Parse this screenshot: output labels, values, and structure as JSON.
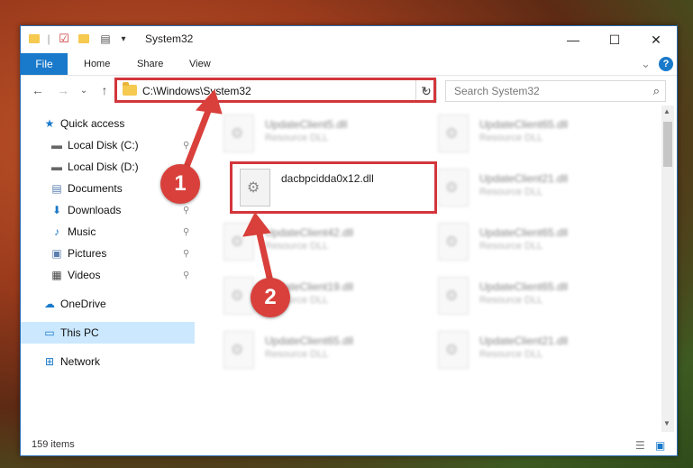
{
  "window": {
    "title": "System32",
    "minimize": "—",
    "maximize": "☐",
    "close": "✕"
  },
  "ribbon": {
    "file": "File",
    "home": "Home",
    "share": "Share",
    "view": "View",
    "collapse": "⌄",
    "help": "?"
  },
  "nav": {
    "back": "←",
    "forward": "→",
    "recent": "⌄",
    "up": "↑",
    "address": "C:\\Windows\\System32",
    "address_chevron": "⌄",
    "refresh": "↻",
    "search_placeholder": "Search System32",
    "search_icon": "⌕"
  },
  "sidebar": {
    "items": [
      {
        "label": "Quick access",
        "icon": "star-icon",
        "glyph": "★",
        "pinned": false
      },
      {
        "label": "Local Disk (C:)",
        "icon": "drive-icon",
        "glyph": "▬",
        "pinned": true
      },
      {
        "label": "Local Disk (D:)",
        "icon": "drive-icon",
        "glyph": "▬",
        "pinned": true
      },
      {
        "label": "Documents",
        "icon": "documents-icon",
        "glyph": "▤",
        "pinned": true
      },
      {
        "label": "Downloads",
        "icon": "download-icon",
        "glyph": "⬇",
        "pinned": true
      },
      {
        "label": "Music",
        "icon": "music-icon",
        "glyph": "♪",
        "pinned": true
      },
      {
        "label": "Pictures",
        "icon": "pictures-icon",
        "glyph": "▣",
        "pinned": true
      },
      {
        "label": "Videos",
        "icon": "videos-icon",
        "glyph": "▦",
        "pinned": true
      },
      {
        "label": "OneDrive",
        "icon": "cloud-icon",
        "glyph": "☁",
        "pinned": false
      },
      {
        "label": "This PC",
        "icon": "computer-icon",
        "glyph": "▭",
        "pinned": false
      },
      {
        "label": "Network",
        "icon": "network-icon",
        "glyph": "⊞",
        "pinned": false
      }
    ],
    "pin_glyph": "📌"
  },
  "files": {
    "highlighted": {
      "name": "dacbpcidda0x12.dll",
      "type": ""
    },
    "others": [
      {
        "name": "UpdateClient5.dll",
        "type": "Resource DLL"
      },
      {
        "name": "UpdateClient65.dll",
        "type": "Resource DLL"
      },
      {
        "name": "UpdateClient21.dll",
        "type": "Resource DLL"
      },
      {
        "name": "UpdateClient42.dll",
        "type": "Resource DLL"
      },
      {
        "name": "UpdateClient65.dll",
        "type": "Resource DLL"
      },
      {
        "name": "UpdateClient19.dll",
        "type": "Resource DLL"
      },
      {
        "name": "UpdateClient65.dll",
        "type": "Resource DLL"
      },
      {
        "name": "UpdateClient65.dll",
        "type": "Resource DLL"
      },
      {
        "name": "UpdateClient21.dll",
        "type": "Resource DLL"
      }
    ]
  },
  "status": {
    "count": "159 items"
  },
  "annotations": {
    "step1": "1",
    "step2": "2",
    "accent": "#d2363b"
  }
}
